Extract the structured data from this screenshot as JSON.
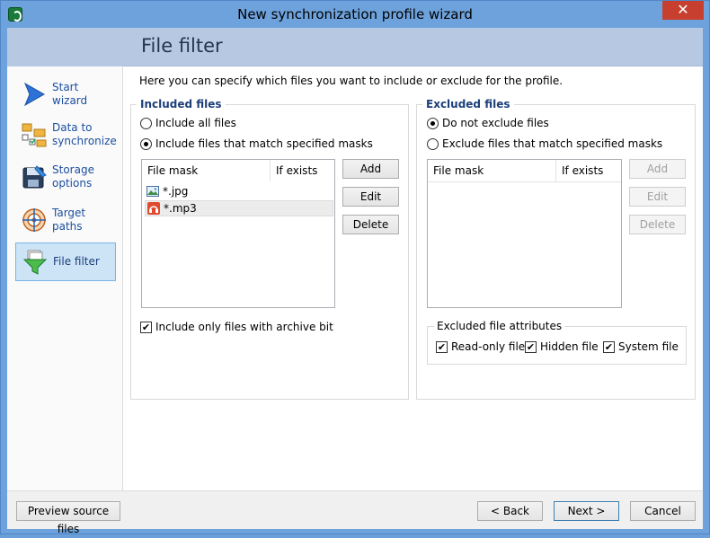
{
  "window": {
    "title": "New synchronization profile wizard",
    "close_glyph": "✕"
  },
  "header": {
    "title": "File filter"
  },
  "sidebar": {
    "items": [
      {
        "label": "Start wizard",
        "icon": "arrow-icon"
      },
      {
        "label": "Data to synchronize",
        "icon": "folders-icon"
      },
      {
        "label": "Storage options",
        "icon": "disk-icon"
      },
      {
        "label": "Target paths",
        "icon": "target-icon"
      },
      {
        "label": "File filter",
        "icon": "funnel-icon",
        "active": true
      }
    ]
  },
  "main": {
    "intro": "Here you can specify which files you want to include or exclude for the profile.",
    "included": {
      "title": "Included files",
      "option_all": "Include all files",
      "option_masks": "Include files that match specified masks",
      "selected_option": "masks",
      "columns": [
        "File mask",
        "If exists"
      ],
      "rows": [
        {
          "mask": "*.jpg",
          "icon": "image-file-icon"
        },
        {
          "mask": "*.mp3",
          "icon": "audio-file-icon"
        }
      ],
      "buttons": {
        "add": "Add",
        "edit": "Edit",
        "delete": "Delete"
      },
      "archive_bit_label": "Include only files with archive bit",
      "archive_bit_checked": true
    },
    "excluded": {
      "title": "Excluded files",
      "option_none": "Do not exclude files",
      "option_masks": "Exclude files that match specified masks",
      "selected_option": "none",
      "columns": [
        "File mask",
        "If exists"
      ],
      "buttons": {
        "add": "Add",
        "edit": "Edit",
        "delete": "Delete"
      },
      "attributes": {
        "title": "Excluded file attributes",
        "readonly": "Read-only file",
        "hidden": "Hidden file",
        "system": "System file"
      }
    }
  },
  "footer": {
    "preview": "Preview source files",
    "back": "< Back",
    "next": "Next >",
    "cancel": "Cancel"
  },
  "colors": {
    "accent": "#1c4fa0",
    "header_bg": "#b7c9e2",
    "frame": "#6da2dc"
  }
}
